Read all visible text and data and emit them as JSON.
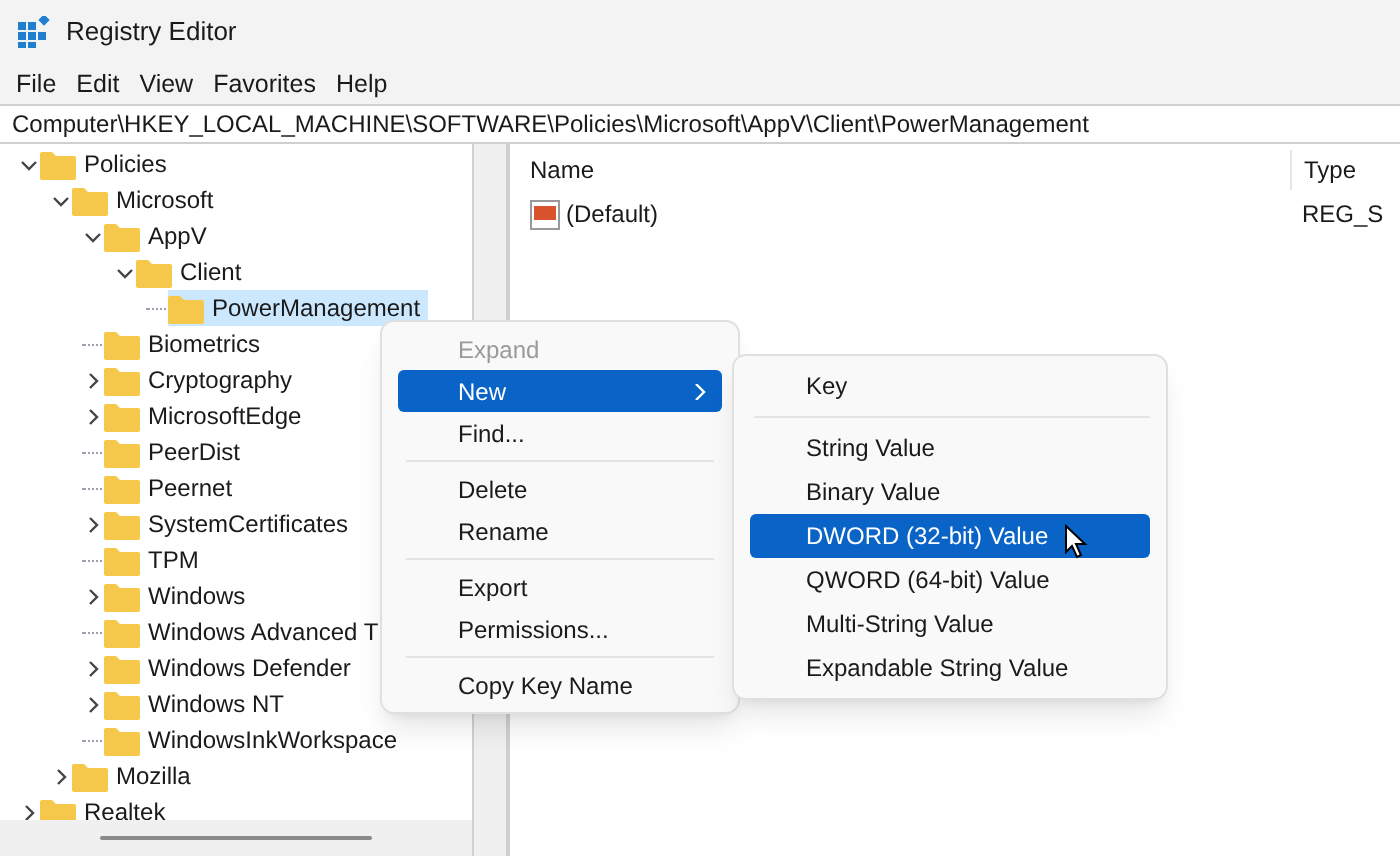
{
  "window": {
    "title": "Registry Editor"
  },
  "menu_bar": [
    "File",
    "Edit",
    "View",
    "Favorites",
    "Help"
  ],
  "address": "Computer\\HKEY_LOCAL_MACHINE\\SOFTWARE\\Policies\\Microsoft\\AppV\\Client\\PowerManagement",
  "tree": [
    {
      "kind": "branch",
      "label": "Policies",
      "expanded": true,
      "selected": false,
      "children": [
        {
          "kind": "branch",
          "label": "Microsoft",
          "expanded": true,
          "selected": false,
          "children": [
            {
              "kind": "branch",
              "label": "AppV",
              "expanded": true,
              "selected": false,
              "children": [
                {
                  "kind": "branch",
                  "label": "Client",
                  "expanded": true,
                  "selected": false,
                  "children": [
                    {
                      "kind": "leaf",
                      "label": "PowerManagement",
                      "selected": true
                    }
                  ]
                }
              ]
            },
            {
              "kind": "leaf",
              "label": "Biometrics",
              "selected": false
            },
            {
              "kind": "branch",
              "label": "Cryptography",
              "expanded": false,
              "selected": false
            },
            {
              "kind": "branch",
              "label": "MicrosoftEdge",
              "expanded": false,
              "selected": false
            },
            {
              "kind": "leaf",
              "label": "PeerDist",
              "selected": false
            },
            {
              "kind": "leaf",
              "label": "Peernet",
              "selected": false
            },
            {
              "kind": "branch",
              "label": "SystemCertificates",
              "expanded": false,
              "selected": false
            },
            {
              "kind": "leaf",
              "label": "TPM",
              "selected": false
            },
            {
              "kind": "branch",
              "label": "Windows",
              "expanded": false,
              "selected": false
            },
            {
              "kind": "leaf",
              "label": "Windows Advanced T",
              "selected": false
            },
            {
              "kind": "branch",
              "label": "Windows Defender",
              "expanded": false,
              "selected": false
            },
            {
              "kind": "branch",
              "label": "Windows NT",
              "expanded": false,
              "selected": false
            },
            {
              "kind": "leaf",
              "label": "WindowsInkWorkspace",
              "selected": false
            }
          ]
        },
        {
          "kind": "branch",
          "label": "Mozilla",
          "expanded": false,
          "selected": false
        }
      ]
    },
    {
      "kind": "branch",
      "label": "Realtek",
      "expanded": false,
      "selected": false
    }
  ],
  "list": {
    "columns": [
      "Name",
      "Type"
    ],
    "rows": [
      {
        "name": "(Default)",
        "type": "REG_S"
      }
    ]
  },
  "context_menu": [
    {
      "kind": "item",
      "label": "Expand",
      "disabled": true,
      "selected": false,
      "submenu": false
    },
    {
      "kind": "item",
      "label": "New",
      "disabled": false,
      "selected": true,
      "submenu": true
    },
    {
      "kind": "item",
      "label": "Find...",
      "disabled": false,
      "selected": false,
      "submenu": false
    },
    {
      "kind": "separator"
    },
    {
      "kind": "item",
      "label": "Delete",
      "disabled": false,
      "selected": false,
      "submenu": false
    },
    {
      "kind": "item",
      "label": "Rename",
      "disabled": false,
      "selected": false,
      "submenu": false
    },
    {
      "kind": "separator"
    },
    {
      "kind": "item",
      "label": "Export",
      "disabled": false,
      "selected": false,
      "submenu": false
    },
    {
      "kind": "item",
      "label": "Permissions...",
      "disabled": false,
      "selected": false,
      "submenu": false
    },
    {
      "kind": "separator"
    },
    {
      "kind": "item",
      "label": "Copy Key Name",
      "disabled": false,
      "selected": false,
      "submenu": false
    }
  ],
  "submenu": [
    {
      "kind": "item",
      "label": "Key",
      "selected": false
    },
    {
      "kind": "separator"
    },
    {
      "kind": "item",
      "label": "String Value",
      "selected": false
    },
    {
      "kind": "item",
      "label": "Binary Value",
      "selected": false
    },
    {
      "kind": "item",
      "label": "DWORD (32-bit) Value",
      "selected": true
    },
    {
      "kind": "item",
      "label": "QWORD (64-bit) Value",
      "selected": false
    },
    {
      "kind": "item",
      "label": "Multi-String Value",
      "selected": false
    },
    {
      "kind": "item",
      "label": "Expandable String Value",
      "selected": false
    }
  ]
}
